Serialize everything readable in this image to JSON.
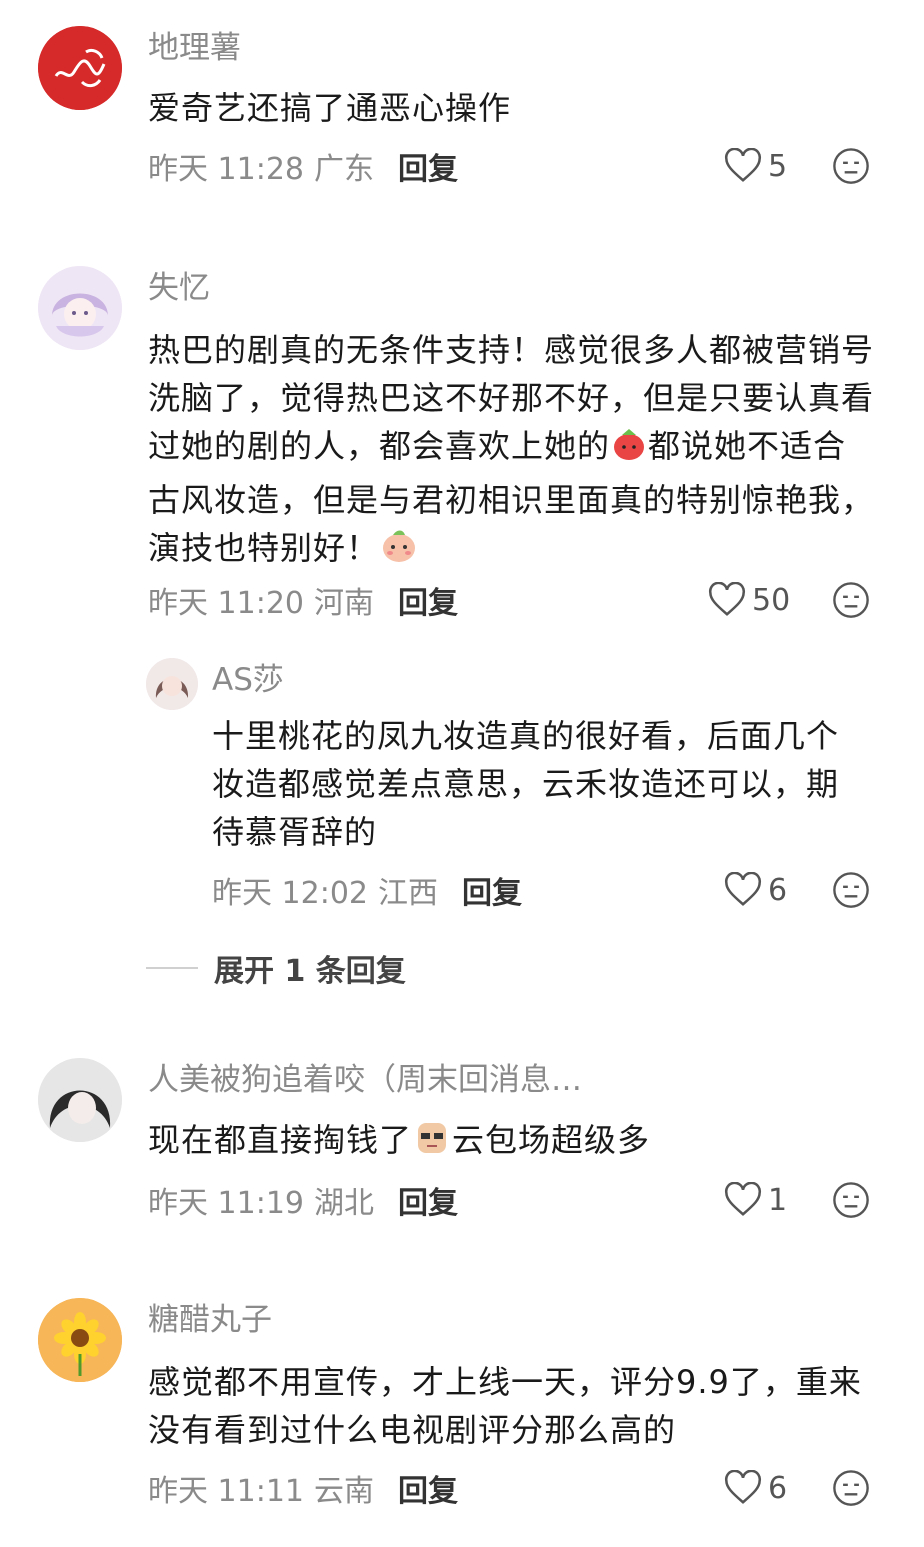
{
  "comments": [
    {
      "username": "地理薯",
      "text": "爱奇艺还搞了通恶心操作",
      "time": "昨天 11:28",
      "region": "广东",
      "reply_label": "回复",
      "likes": "5"
    },
    {
      "username": "失忆",
      "text_a": "热巴的剧真的无条件支持！感觉很多人都被营销号洗脑了，觉得热巴这不好那不好，但是只要认真看过她的剧的人，都会喜欢上她的",
      "text_b": "都说她不适合古风妆造，但是与君初相识里面真的特别惊艳我，演技也特别好！",
      "time": "昨天 11:20",
      "region": "河南",
      "reply_label": "回复",
      "likes": "50"
    },
    {
      "username": "AS莎",
      "text": "十里桃花的凤九妆造真的很好看，后面几个妆造都感觉差点意思，云禾妆造还可以，期待慕胥辞的",
      "time": "昨天 12:02",
      "region": "江西",
      "reply_label": "回复",
      "likes": "6"
    },
    {
      "username": "人美被狗追着咬（周末回消息…",
      "text_a": "现在都直接掏钱了",
      "text_b": "云包场超级多",
      "time": "昨天 11:19",
      "region": "湖北",
      "reply_label": "回复",
      "likes": "1"
    },
    {
      "username": "糖醋丸子",
      "text": "感觉都不用宣传，才上线一天，评分9.9了，重来没有看到过什么电视剧评分那么高的",
      "time": "昨天 11:11",
      "region": "云南",
      "reply_label": "回复",
      "likes": "6"
    }
  ],
  "expand_replies": "展开 1 条回复",
  "icons": {
    "like": "heart-outline-icon",
    "dislike": "neutral-face-icon"
  },
  "colors": {
    "muted": "#8a8a8a",
    "text": "#1a1a1a",
    "avatar_red": "#d62a2a"
  }
}
